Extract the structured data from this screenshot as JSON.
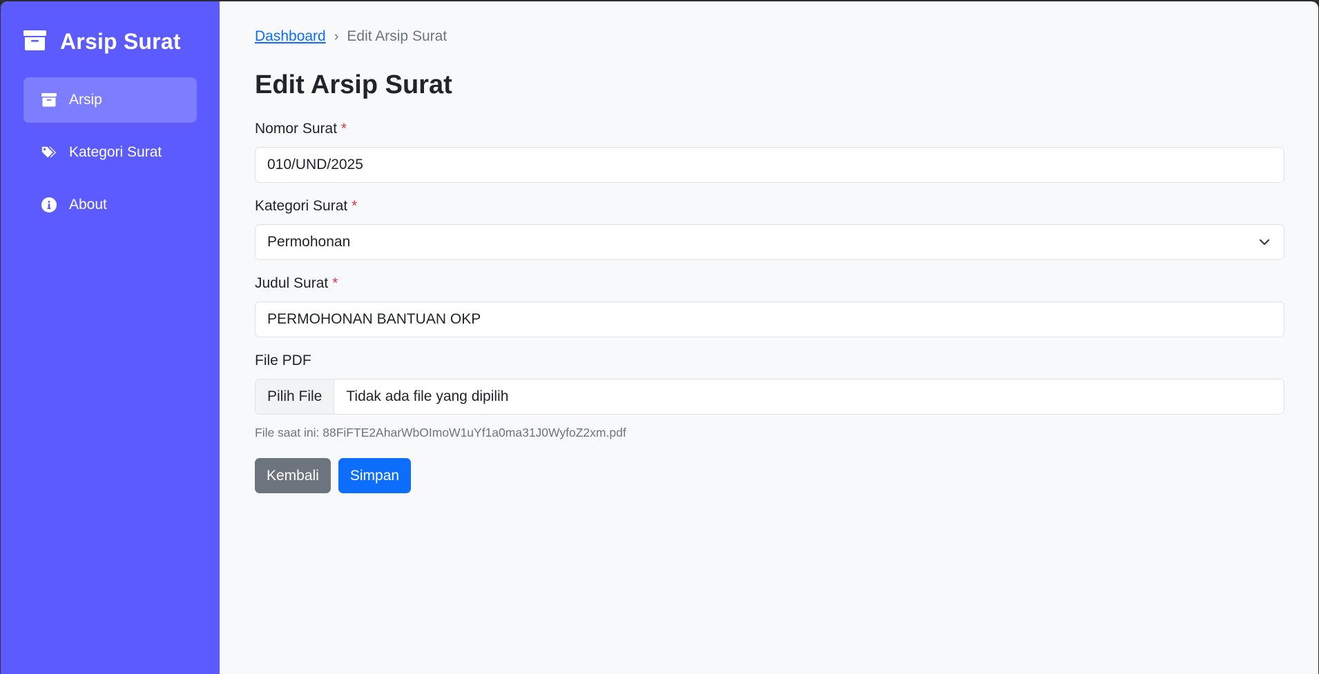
{
  "sidebar": {
    "brand_title": "Arsip Surat",
    "brand_icon": "archive-icon",
    "items": [
      {
        "label": "Arsip",
        "icon": "archive-icon",
        "active": true
      },
      {
        "label": "Kategori Surat",
        "icon": "tags-icon",
        "active": false
      },
      {
        "label": "About",
        "icon": "info-circle-icon",
        "active": false
      }
    ]
  },
  "breadcrumb": {
    "home": "Dashboard",
    "separator": "›",
    "current": "Edit Arsip Surat"
  },
  "page": {
    "title": "Edit Arsip Surat"
  },
  "form": {
    "required_marker": "*",
    "nomor": {
      "label": "Nomor Surat",
      "value": "010/UND/2025"
    },
    "kategori": {
      "label": "Kategori Surat",
      "value": "Permohonan"
    },
    "judul": {
      "label": "Judul Surat",
      "value": "PERMOHONAN BANTUAN OKP"
    },
    "file": {
      "label": "File PDF",
      "button_label": "Pilih File",
      "status": "Tidak ada file yang dipilih",
      "current": "File saat ini: 88FiFTE2AharWbOImoW1uYf1a0ma31J0WyfoZ2xm.pdf"
    }
  },
  "actions": {
    "back_label": "Kembali",
    "save_label": "Simpan"
  },
  "colors": {
    "sidebar": "#5b5bff",
    "active_item": "#7d7dff",
    "primary": "#0d6efd",
    "secondary": "#6c757d",
    "required": "#dc3545"
  }
}
